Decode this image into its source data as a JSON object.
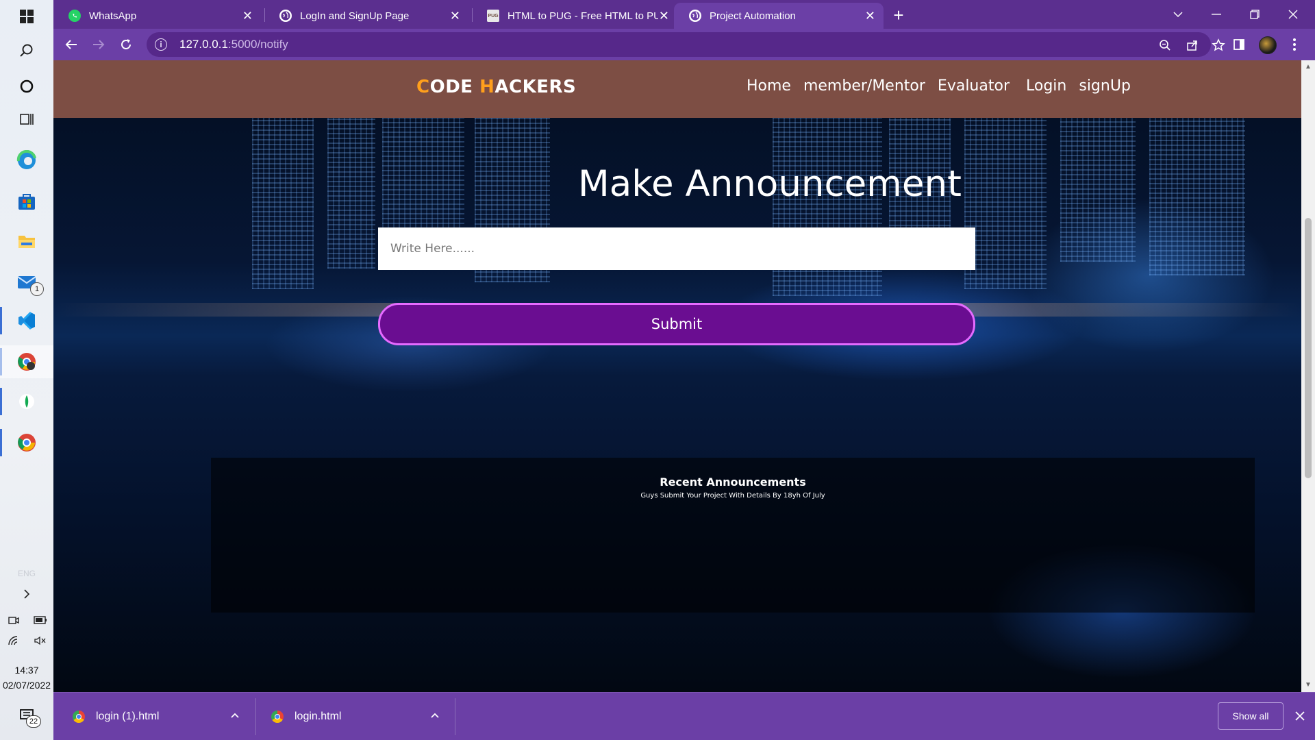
{
  "taskbar": {
    "items": [
      {
        "name": "start-windows-icon"
      },
      {
        "name": "search-icon"
      },
      {
        "name": "cortana-icon"
      },
      {
        "name": "task-view-icon"
      },
      {
        "name": "edge-icon"
      },
      {
        "name": "store-icon"
      },
      {
        "name": "file-explorer-icon"
      },
      {
        "name": "mail-icon"
      },
      {
        "name": "vscode-icon"
      },
      {
        "name": "chrome-profile-icon"
      },
      {
        "name": "mongodb-compass-icon"
      },
      {
        "name": "chrome-icon"
      }
    ],
    "mail_badge": "1",
    "language": "ENG",
    "clock_time": "14:37",
    "clock_date": "02/07/2022",
    "notification_count": "22"
  },
  "browser": {
    "tabs": [
      {
        "title": "WhatsApp",
        "favicon": "whatsapp-icon",
        "active": false
      },
      {
        "title": "LogIn and SignUp Page",
        "favicon": "globe-icon",
        "active": false
      },
      {
        "title": "HTML to PUG - Free HTML to PUG",
        "favicon": "pug-icon",
        "active": false
      },
      {
        "title": "Project Automation",
        "favicon": "globe-icon",
        "active": true
      }
    ],
    "url_host": "127.0.0.1",
    "url_rest": ":5000/notify",
    "accent_color": "#6b3fa6",
    "tabstrip_color": "#5b2f8f"
  },
  "site": {
    "brand_c": "C",
    "brand_ode": "ODE ",
    "brand_h": "H",
    "brand_ackers": "ACKERS",
    "brand_accent_color": "#ff9f1c",
    "nav_color": "#7d4e44",
    "nav_links": [
      "Home",
      "member/Mentor",
      "Evaluator",
      "Login",
      "signUp"
    ],
    "heading": "Make Announcement",
    "input_placeholder": "Write Here......",
    "submit_label": "Submit",
    "submit_color": "#6a0d91",
    "recent_title": "Recent Announcements",
    "recent_items": [
      "Guys Submit Your Project With Details By 18yh Of July"
    ]
  },
  "downloads": {
    "items": [
      "login (1).html",
      "login.html"
    ],
    "show_all": "Show all"
  }
}
